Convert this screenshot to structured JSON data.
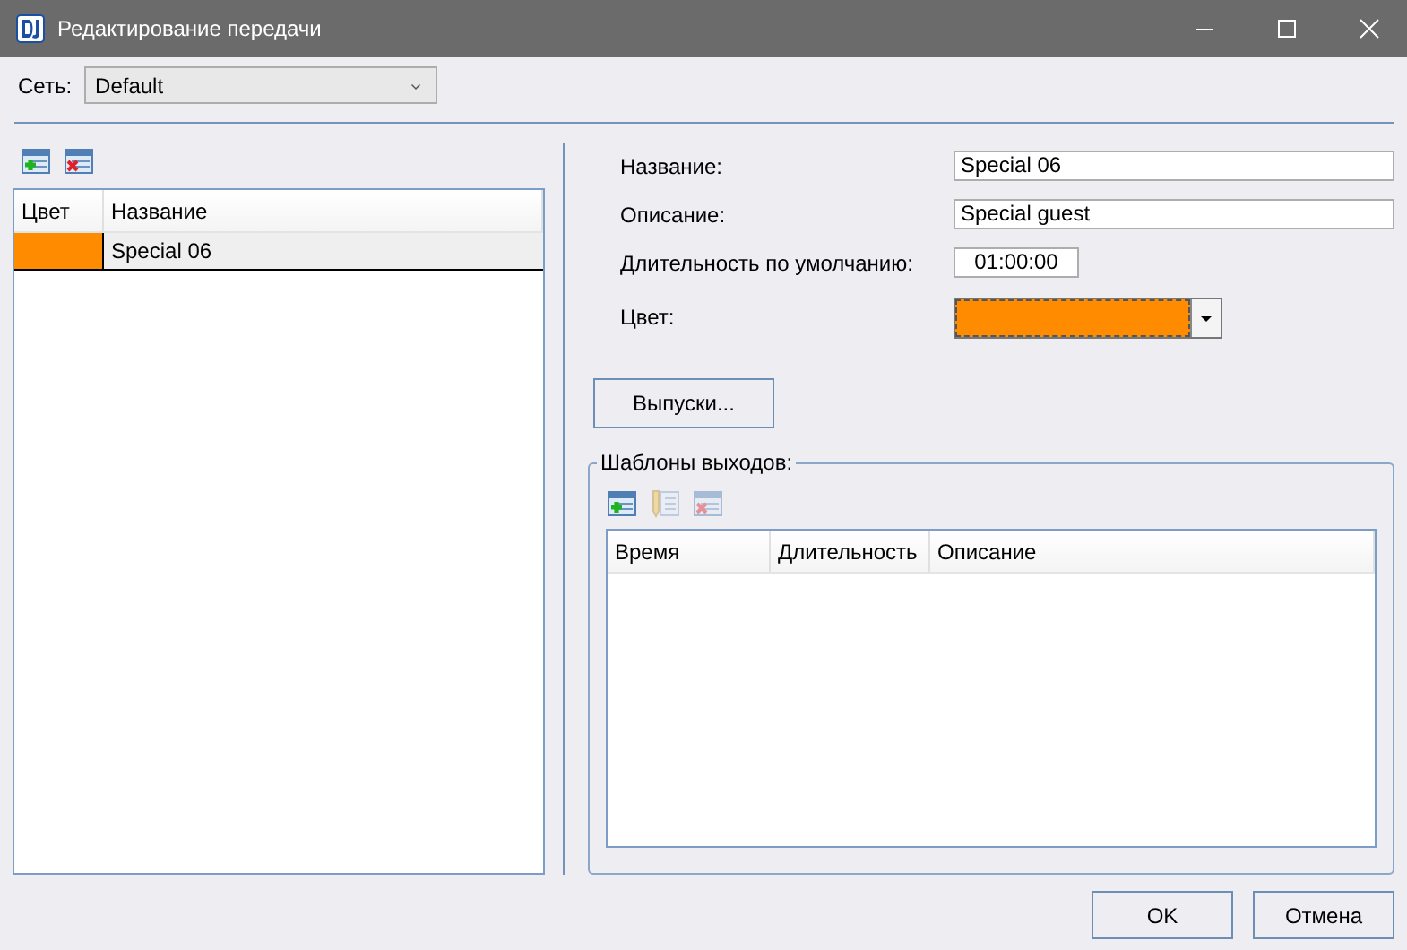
{
  "window": {
    "title": "Редактирование передачи"
  },
  "network": {
    "label": "Сеть:",
    "value": "Default"
  },
  "shows": {
    "toolbar": [
      {
        "kind": "add",
        "disabled": false
      },
      {
        "kind": "delete",
        "disabled": false
      }
    ],
    "columns": [
      "Цвет",
      "Название"
    ],
    "rows": [
      {
        "color": "#ff8c00",
        "name": "Special 06",
        "selected": true
      }
    ]
  },
  "form": {
    "fields": [
      {
        "kind": "text",
        "label": "Название:",
        "value": "Special 06"
      },
      {
        "kind": "text",
        "label": "Описание:",
        "value": "Special guest"
      },
      {
        "kind": "time",
        "label": "Длительность по умолчанию:",
        "value": "01:00:00"
      },
      {
        "kind": "color",
        "label": "Цвет:",
        "color": "#ff8c00"
      }
    ]
  },
  "episodes_button": "Выпуски...",
  "templates": {
    "title": "Шаблоны выходов:",
    "toolbar": [
      {
        "kind": "add",
        "disabled": false
      },
      {
        "kind": "edit",
        "disabled": true
      },
      {
        "kind": "delete",
        "disabled": true
      }
    ],
    "columns": [
      "Время",
      "Длительность",
      "Описание"
    ]
  },
  "buttons": [
    "OK",
    "Отмена"
  ]
}
